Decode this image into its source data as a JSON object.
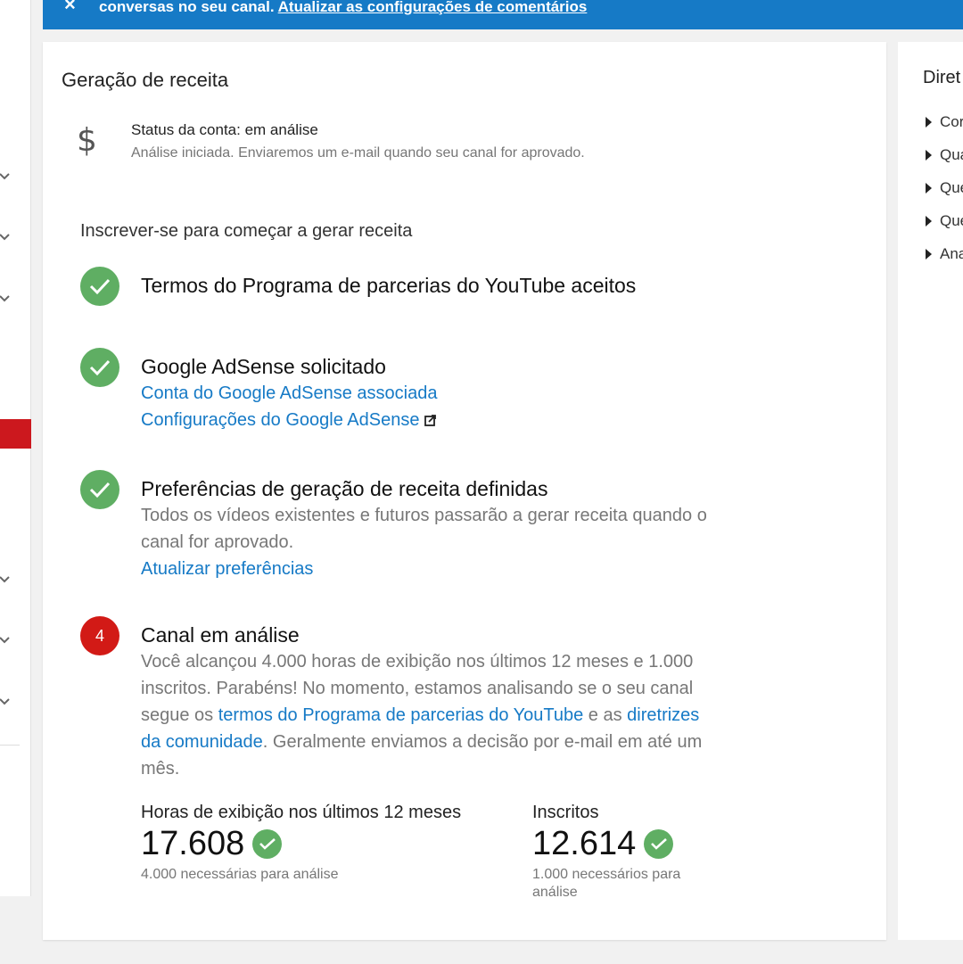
{
  "banner": {
    "text": "conversas no seu canal.",
    "link": "Atualizar as configurações de comentários"
  },
  "card": {
    "title": "Geração de receita",
    "status": {
      "icon": "dollar-icon",
      "line1": "Status da conta: em análise",
      "line2": "Análise iniciada. Enviaremos um e-mail quando seu canal for aprovado."
    },
    "subtitle": "Inscrever-se para começar a gerar receita",
    "steps": [
      {
        "state": "done",
        "head": "Termos do Programa de parcerias do YouTube aceitos"
      },
      {
        "state": "done",
        "head": "Google AdSense solicitado",
        "link1": "Conta do Google AdSense associada",
        "link2": "Configurações do Google AdSense"
      },
      {
        "state": "done",
        "head": "Preferências de geração de receita definidas",
        "desc": "Todos os vídeos existentes e futuros passarão a gerar receita quando o canal for aprovado.",
        "link": "Atualizar preferências"
      },
      {
        "state": "pending",
        "number": "4",
        "head": "Canal em análise",
        "desc_part1": "Você alcançou 4.000 horas de exibição nos últimos 12 meses e 1.000 inscritos. Parabéns! No momento, estamos analisando se o seu canal segue os ",
        "link_terms": "termos do Programa de parcerias do YouTube",
        "desc_part2": " e as ",
        "link_guidelines": "diretrizes da comunidade",
        "desc_part3": ". Geralmente enviamos a decisão por e-mail em até um mês."
      }
    ],
    "metrics": [
      {
        "label": "Horas de exibição nos últimos 12 meses",
        "value": "17.608",
        "note": "4.000 necessárias para análise"
      },
      {
        "label": "Inscritos",
        "value": "12.614",
        "note": "1.000 necessários para análise"
      }
    ]
  },
  "right_panel": {
    "title": "Diret",
    "items": [
      "Cor",
      "Qua",
      "Que",
      "Que",
      "Ana"
    ]
  },
  "colors": {
    "banner": "#167ac6",
    "link": "#167ac6",
    "success": "#5fae63",
    "pending": "#d21a16",
    "sidebar_active": "#cc181e"
  }
}
